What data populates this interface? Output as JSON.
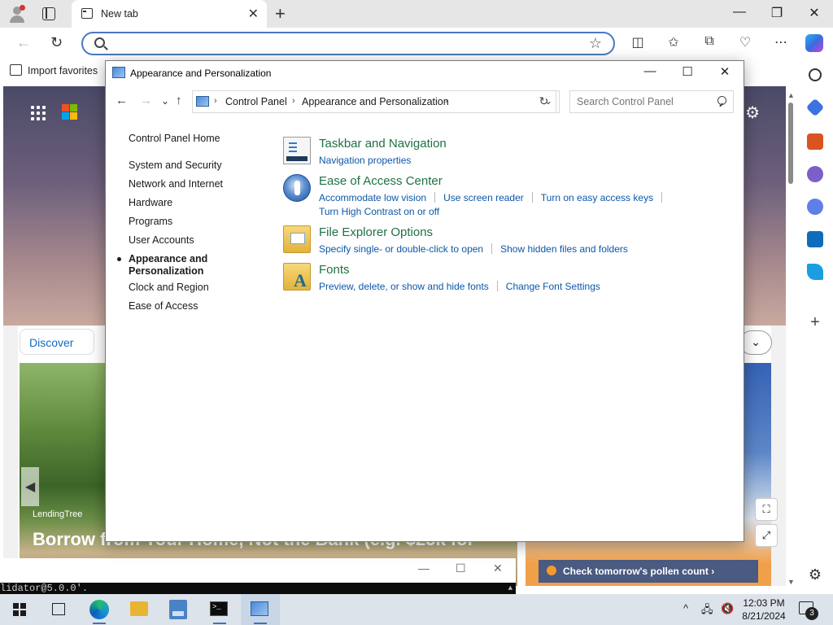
{
  "browser": {
    "tab_title": "New tab",
    "tab_close": "✕",
    "new_tab": "+",
    "back": "←",
    "refresh": "↻",
    "address_value": "",
    "favorite_star": "☆",
    "favorites_bar": {
      "import_label": "Import favorites"
    },
    "window_controls": {
      "minimize": "—",
      "restore": "❐",
      "close": "✕"
    },
    "toolbar_icons": {
      "split": "◫",
      "favorites": "✩",
      "collections": "⧉",
      "performance": "♡",
      "more": "⋯"
    }
  },
  "ntp": {
    "discover_label": "Discover",
    "chevron": "⌄",
    "news_source": "LendingTree",
    "news_headline": "Borrow from Your Home, Not the Bank (e.g. $25k for",
    "news_prev": "◀",
    "pollen_label": "Check tomorrow's pollen count ›",
    "gear": "⚙"
  },
  "terminal": {
    "text": "lidator@5.0.0'.",
    "minimize": "—",
    "maximize": "☐",
    "close": "✕",
    "scroll_up": "▲"
  },
  "control_panel": {
    "window_title": "Appearance and Personalization",
    "window_controls": {
      "minimize": "—",
      "maximize": "☐",
      "close": "✕"
    },
    "nav": {
      "back": "←",
      "forward": "→",
      "history": "⌄",
      "up": "↑"
    },
    "breadcrumb": [
      "Control Panel",
      "Appearance and Personalization"
    ],
    "breadcrumb_sep": "›",
    "address_dropdown": "⌄",
    "refresh": "↻",
    "search_placeholder": "Search Control Panel",
    "left_nav": [
      {
        "label": "Control Panel Home"
      },
      {
        "label": "System and Security"
      },
      {
        "label": "Network and Internet"
      },
      {
        "label": "Hardware"
      },
      {
        "label": "Programs"
      },
      {
        "label": "User Accounts"
      },
      {
        "label": "Appearance and Personalization",
        "active": true
      },
      {
        "label": "Clock and Region"
      },
      {
        "label": "Ease of Access"
      }
    ],
    "sections": [
      {
        "title": "Taskbar and Navigation",
        "icon": "taskbar-icon",
        "links": [
          "Navigation properties"
        ]
      },
      {
        "title": "Ease of Access Center",
        "icon": "ease-of-access-icon",
        "links": [
          "Accommodate low vision",
          "Use screen reader",
          "Turn on easy access keys",
          "Turn High Contrast on or off"
        ]
      },
      {
        "title": "File Explorer Options",
        "icon": "folder-options-icon",
        "links": [
          "Specify single- or double-click to open",
          "Show hidden files and folders"
        ]
      },
      {
        "title": "Fonts",
        "icon": "fonts-icon",
        "links": [
          "Preview, delete, or show and hide fonts",
          "Change Font Settings"
        ]
      }
    ]
  },
  "taskbar": {
    "clock_time": "12:03 PM",
    "clock_date": "8/21/2024",
    "notification_count": "3",
    "tray_chevron": "^"
  },
  "colors": {
    "link": "#0b57a8",
    "section_title": "#1e7145",
    "address_focus": "#4a78c2",
    "taskbar": "#dde3ea"
  }
}
